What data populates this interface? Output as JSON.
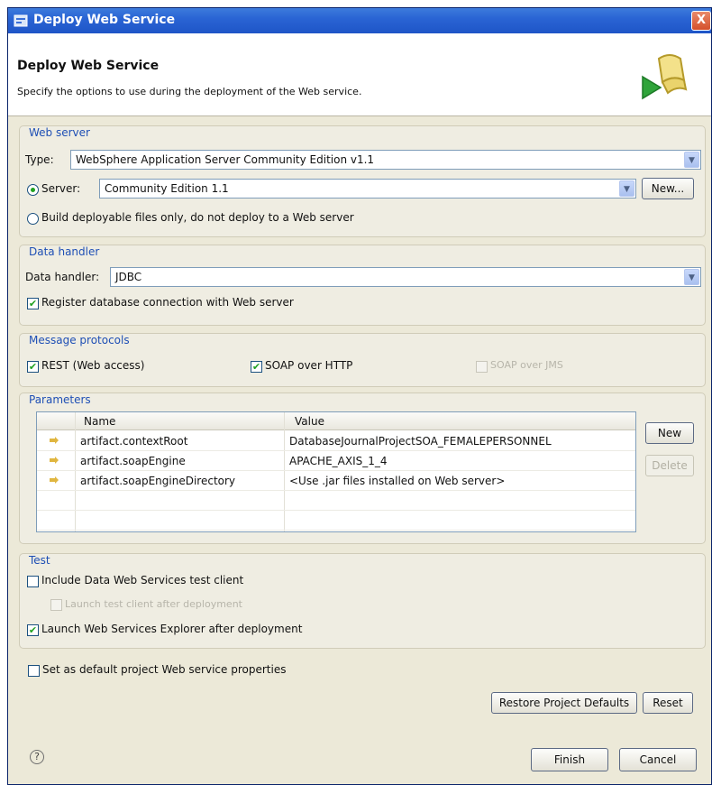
{
  "window": {
    "title": "Deploy Web Service"
  },
  "banner": {
    "heading": "Deploy Web Service",
    "description": "Specify the options to use during the deployment of the Web service."
  },
  "web_server": {
    "title": "Web server",
    "type_label": "Type:",
    "type_value": "WebSphere Application Server Community Edition v1.1",
    "server_label": "Server:",
    "server_value": "Community Edition 1.1",
    "new_button": "New...",
    "build_only_label": "Build deployable files only, do not deploy to a Web server"
  },
  "data_handler": {
    "title": "Data handler",
    "label": "Data handler:",
    "value": "JDBC",
    "register_label": "Register database connection with Web server"
  },
  "message_protocols": {
    "title": "Message protocols",
    "rest_label": "REST (Web access)",
    "soap_http_label": "SOAP over HTTP",
    "soap_jms_label": "SOAP over JMS"
  },
  "parameters": {
    "title": "Parameters",
    "columns": [
      "Name",
      "Value"
    ],
    "rows": [
      {
        "name": "artifact.contextRoot",
        "value": "DatabaseJournalProjectSOA_FEMALEPERSONNEL"
      },
      {
        "name": "artifact.soapEngine",
        "value": "APACHE_AXIS_1_4"
      },
      {
        "name": "artifact.soapEngineDirectory",
        "value": "<Use .jar files installed on Web server>"
      }
    ],
    "new_button": "New",
    "delete_button": "Delete"
  },
  "test": {
    "title": "Test",
    "include_client_label": "Include Data Web Services test client",
    "launch_client_label": "Launch test client after deployment",
    "launch_explorer_label": "Launch Web Services Explorer after deployment"
  },
  "default_props_label": "Set as default project Web service properties",
  "restore_defaults_button": "Restore Project Defaults",
  "reset_button": "Reset",
  "finish_button": "Finish",
  "cancel_button": "Cancel",
  "help_icon": "?",
  "close_icon": "X",
  "state": {
    "server_radio_selected": true,
    "build_only_selected": false,
    "register_checked": true,
    "rest_checked": true,
    "soap_http_checked": true,
    "soap_jms_checked": false,
    "soap_jms_enabled": false,
    "include_client_checked": false,
    "launch_client_enabled": false,
    "launch_explorer_checked": true,
    "default_props_checked": false
  }
}
